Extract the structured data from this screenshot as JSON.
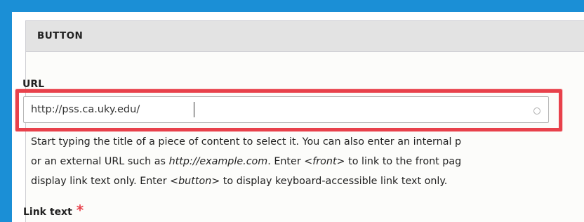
{
  "panel": {
    "title": "BUTTON"
  },
  "url_field": {
    "label": "URL",
    "value": "http://pss.ca.uky.edu/"
  },
  "description": {
    "line1": "Start typing the title of a piece of content to select it. You can also enter an internal p",
    "line2_a": "or an external URL such as ",
    "line2_em1": "http://example.com",
    "line2_b": ". Enter ",
    "line2_em2": "<front>",
    "line2_c": " to link to the front pag",
    "line3_a": "display link text only. Enter ",
    "line3_em": "<button>",
    "line3_b": " to display keyboard-accessible link text only."
  },
  "link_text_field": {
    "label": "Link text",
    "required_mark": "*"
  },
  "colors": {
    "background_border": "#1b8fd6",
    "highlight_box": "#e8414b",
    "panel_header": "#e3e3e3"
  },
  "icons": {
    "autocomplete_throbber": "circle-throbber-icon"
  }
}
